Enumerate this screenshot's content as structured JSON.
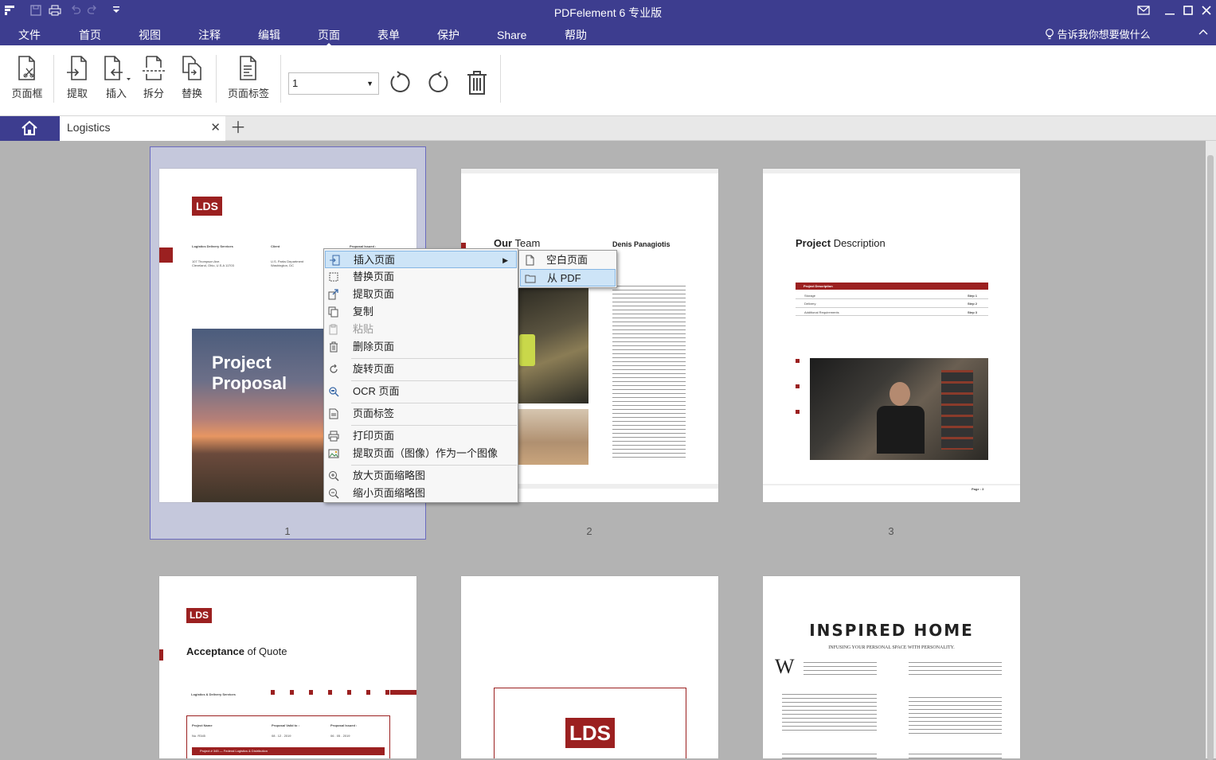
{
  "app": {
    "title": "PDFelement 6 专业版"
  },
  "menu": [
    "文件",
    "首页",
    "视图",
    "注释",
    "编辑",
    "页面",
    "表单",
    "保护",
    "Share",
    "帮助"
  ],
  "active_menu": "页面",
  "tell_me": "告诉我你想要做什么",
  "ribbon": {
    "buttons": [
      "页面框",
      "提取",
      "插入",
      "拆分",
      "替换",
      "页面标签"
    ],
    "page_select_value": "1"
  },
  "tabs": {
    "document": "Logistics"
  },
  "pages": {
    "labels": [
      "1",
      "2",
      "3"
    ],
    "p1": {
      "logo": "LDS",
      "cover_title_1": "Project",
      "cover_title_2": "Proposal",
      "col1": "Logistics Delivery Services",
      "col2": "Client",
      "col3": "Proposal Issued :",
      "addr1": "107 Thompson Ave.",
      "addr2": "Cleveland, Ohio, U.S.A 11703",
      "client1": "U.S. Parks Department",
      "client2": "Washington, DC"
    },
    "p2": {
      "heading_bold": "Our",
      "heading_rest": " Team",
      "name": "Denis Panagiotis"
    },
    "p3": {
      "heading_bold": "Project",
      "heading_rest": " Description",
      "table_head": "Project Description",
      "rows": [
        [
          "Storage",
          "Step 1"
        ],
        [
          "Delivery",
          "Step 2"
        ],
        [
          "Additional Requirements",
          "Step 3"
        ]
      ],
      "footer": "Page : 3"
    },
    "p4": {
      "logo": "LDS",
      "heading_bold": "Acceptance",
      "heading_rest": " of Quote",
      "company": "Logistics & Delivery Services",
      "h1": "Project Name",
      "h2": "Proposal Valid to :",
      "h3": "Proposal Issued :",
      "v1": "No. R345",
      "v2": "08 . 12 . 2019",
      "v3": "06 . 05 . 2019",
      "bar": "Project # 345 — Federal Logistics & Distribution"
    },
    "p5": {
      "logo": "LDS"
    },
    "p6": {
      "title": "INSPIRED HOME",
      "subtitle": "INFUSING YOUR PERSONAL SPACE WITH PERSONALITY.",
      "dropcap": "W"
    }
  },
  "context_menu": {
    "items": [
      "插入页面",
      "替换页面",
      "提取页面",
      "复制",
      "粘贴",
      "删除页面",
      "旋转页面",
      "OCR 页面",
      "页面标签",
      "打印页面",
      "提取页面（图像）作为一个图像",
      "放大页面缩略图",
      "缩小页面缩略图"
    ],
    "submenu": [
      "空白页面",
      "从 PDF"
    ]
  },
  "colors": {
    "brand": "#3d3d8f",
    "accent": "#9b2020",
    "highlight": "#cde4f7"
  }
}
